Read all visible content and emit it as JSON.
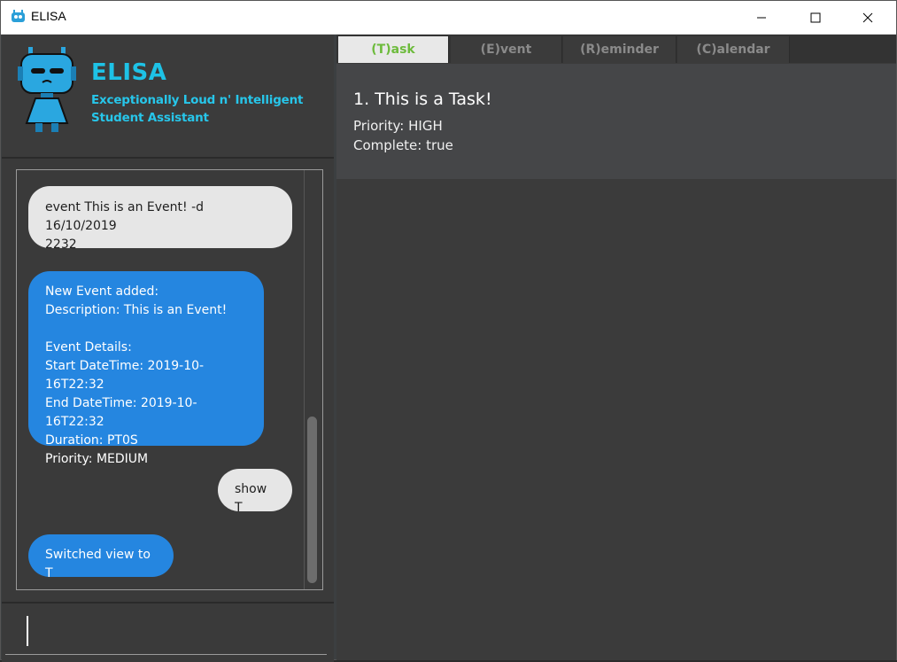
{
  "window": {
    "title": "ELISA",
    "controls": {
      "minimize": "—",
      "maximize": "☐",
      "close": "✕"
    }
  },
  "header": {
    "brand": "ELISA",
    "subtitle_line1": "Exceptionally Loud n' Intelligent",
    "subtitle_line2": "Student Assistant"
  },
  "chat": {
    "messages": [
      {
        "role": "user",
        "text": "event This is an Event! -d 16/10/2019\n2232"
      },
      {
        "role": "bot",
        "text": "New Event added:\nDescription: This is an Event!\n\nEvent Details:\nStart DateTime: 2019-10-16T22:32\nEnd DateTime: 2019-10-16T22:32\nDuration: PT0S\nPriority: MEDIUM"
      },
      {
        "role": "user",
        "text": "show T"
      },
      {
        "role": "bot",
        "text": "Switched view to T"
      }
    ]
  },
  "input": {
    "value": "",
    "placeholder": ""
  },
  "tabs": [
    {
      "label": "(T)ask",
      "active": true
    },
    {
      "label": "(E)vent",
      "active": false
    },
    {
      "label": "(R)eminder",
      "active": false
    },
    {
      "label": "(C)alendar",
      "active": false
    }
  ],
  "tasks": [
    {
      "title": "1.  This is a Task!",
      "priority": "Priority: HIGH",
      "complete": "Complete: true"
    }
  ],
  "colors": {
    "accent": "#1ec2e6",
    "bot_bubble": "#2586e0",
    "user_bubble": "#e6e6e6",
    "active_tab_text": "#6dbb3c"
  }
}
